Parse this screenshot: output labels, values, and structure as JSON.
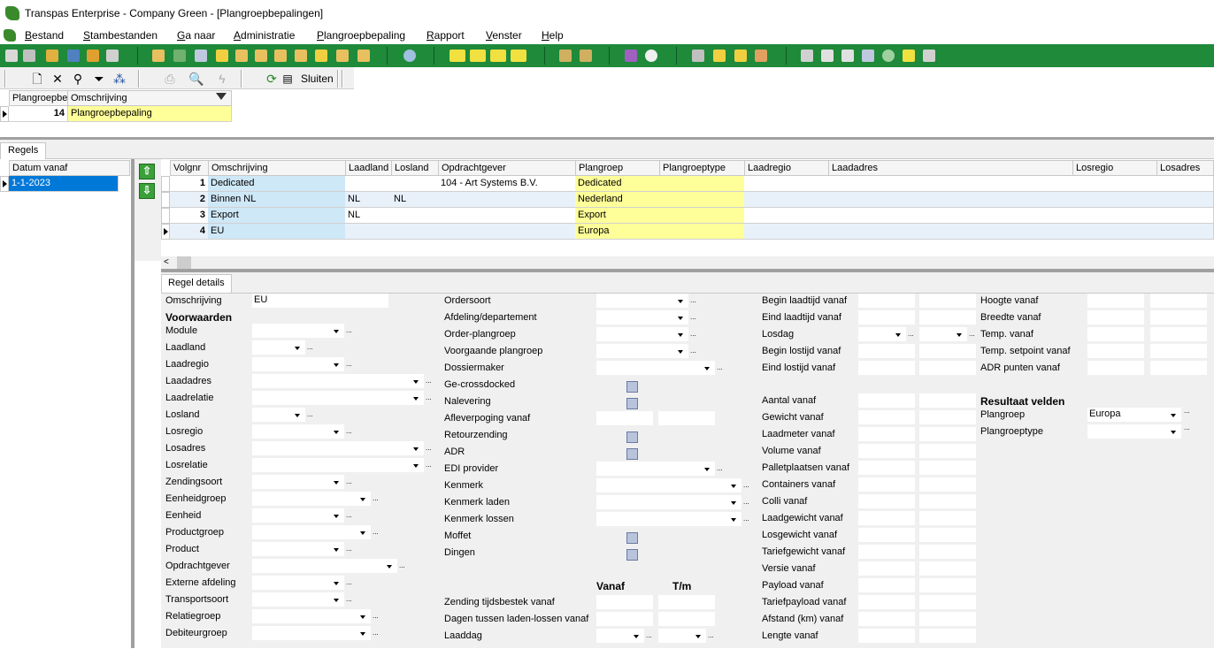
{
  "window": {
    "title": "Transpas Enterprise - Company Green - [Plangroepbepalingen]"
  },
  "menu": [
    "Bestand",
    "Stambestanden",
    "Ga naar",
    "Administratie",
    "Plangroepbepaling",
    "Rapport",
    "Venster",
    "Help"
  ],
  "toolbar": {
    "sluiten_label": "Sluiten"
  },
  "top_grid": {
    "columns": [
      "Plangroepbe",
      "Omschrijving"
    ],
    "row": {
      "number": "14",
      "description": "Plangroepbepaling"
    }
  },
  "tabs": {
    "regels": "Regels"
  },
  "left_grid": {
    "column": "Datum vanaf",
    "value": "1-1-2023"
  },
  "rules_grid": {
    "columns": [
      "Volgnr",
      "Omschrijving",
      "Laadland",
      "Losland",
      "Opdrachtgever",
      "Plangroep",
      "Plangroeptype",
      "Laadregio",
      "Laadadres",
      "Losregio",
      "Losadres"
    ],
    "rows": [
      {
        "volgnr": "1",
        "omschrijving": "Dedicated",
        "laadland": "",
        "losland": "",
        "opdrachtgever": "104 - Art Systems B.V.",
        "plangroep": "Dedicated"
      },
      {
        "volgnr": "2",
        "omschrijving": "Binnen NL",
        "laadland": "NL",
        "losland": "NL",
        "opdrachtgever": "",
        "plangroep": "Nederland"
      },
      {
        "volgnr": "3",
        "omschrijving": "Export",
        "laadland": "NL",
        "losland": "",
        "opdrachtgever": "",
        "plangroep": "Export"
      },
      {
        "volgnr": "4",
        "omschrijving": "EU",
        "laadland": "",
        "losland": "",
        "opdrachtgever": "",
        "plangroep": "Europa"
      }
    ]
  },
  "details": {
    "tab": "Regel details",
    "omschrijving_label": "Omschrijving",
    "omschrijving_value": "EU",
    "voorwaarden_header": "Voorwaarden",
    "col1": [
      "Module",
      "Laadland",
      "Laadregio",
      "Laadadres",
      "Laadrelatie",
      "Losland",
      "Losregio",
      "Losadres",
      "Losrelatie",
      "Zendingsoort",
      "Eenheidgroep",
      "Eenheid",
      "Productgroep",
      "Product",
      "Opdrachtgever",
      "Externe afdeling",
      "Transportsoort",
      "Relatiegroep",
      "Debiteurgroep"
    ],
    "col2": [
      "Ordersoort",
      "Afdeling/departement",
      "Order-plangroep",
      "Voorgaande plangroep",
      "Dossiermaker",
      "Ge-crossdocked",
      "Nalevering",
      "Afleverpoging vanaf",
      "Retourzending",
      "ADR",
      "EDI provider",
      "Kenmerk",
      "Kenmerk laden",
      "Kenmerk lossen",
      "Moffet",
      "Dingen"
    ],
    "vanaf_header": "Vanaf",
    "tm_header": "T/m",
    "col2b": [
      "Zending tijdsbestek vanaf",
      "Dagen tussen laden-lossen vanaf",
      "Laaddag"
    ],
    "col3": [
      "Begin laadtijd vanaf",
      "Eind laadtijd vanaf",
      "Losdag",
      "Begin lostijd vanaf",
      "Eind lostijd vanaf"
    ],
    "col3b": [
      "Aantal vanaf",
      "Gewicht vanaf",
      "Laadmeter vanaf",
      "Volume vanaf",
      "Palletplaatsen vanaf",
      "Containers vanaf",
      "Colli vanaf",
      "Laadgewicht vanaf",
      "Losgewicht vanaf",
      "Tariefgewicht vanaf",
      "Versie vanaf",
      "Payload vanaf",
      "Tariefpayload vanaf",
      "Afstand (km) vanaf",
      "Lengte vanaf"
    ],
    "col4": [
      "Hoogte vanaf",
      "Breedte vanaf",
      "Temp. vanaf",
      "Temp. setpoint vanaf",
      "ADR punten vanaf"
    ],
    "resultaat_header": "Resultaat velden",
    "plangroep_label": "Plangroep",
    "plangroep_value": "Europa",
    "plangroeptype_label": "Plangroeptype"
  },
  "colors": {
    "green_toolbar": "#1e8a3a",
    "yellow_cell": "#ffff99",
    "blue_cell": "#cfe8f7",
    "selected": "#0078d7"
  }
}
